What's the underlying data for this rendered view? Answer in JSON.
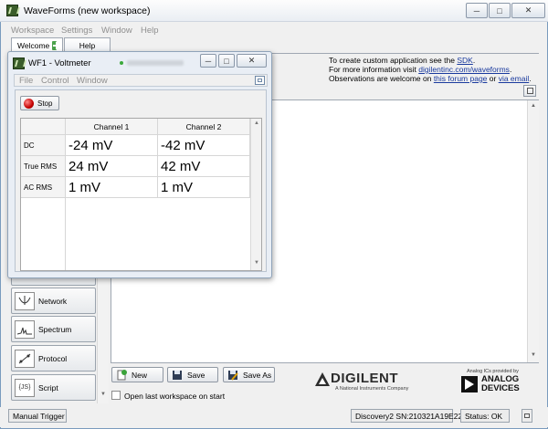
{
  "main_window": {
    "title": "WaveForms  (new workspace)",
    "menu": [
      "Workspace",
      "Settings",
      "Window",
      "Help"
    ],
    "tabs": [
      {
        "label": "Welcome"
      },
      {
        "label": "Help"
      }
    ]
  },
  "info": {
    "line1_prefix": "To create custom application see the ",
    "line1_link": "SDK",
    "line1_suffix": ".",
    "line2_prefix": "For more information visit ",
    "line2_link": "digilentinc.com/waveforms",
    "line2_suffix": ".",
    "line3_prefix": "Observations are welcome on ",
    "line3_link1": "this forum page",
    "line3_mid": " or ",
    "line3_link2": "via email",
    "line3_suffix": "."
  },
  "sidebar": {
    "items": [
      {
        "label": "Network",
        "icon": "network-icon"
      },
      {
        "label": "Spectrum",
        "icon": "spectrum-icon"
      },
      {
        "label": "Protocol",
        "icon": "protocol-icon"
      },
      {
        "label": "Script",
        "icon_text": "{JS}",
        "icon": "script-icon"
      }
    ]
  },
  "bottom": {
    "new_label": "New",
    "save_label": "Save",
    "saveas_label": "Save As",
    "open_last_label": "Open last workspace on start",
    "open_last_checked": false
  },
  "logos": {
    "digilent_name": "DIGILENT",
    "digilent_tag": "A National Instruments Company",
    "adi_caption": "Analog ICs provided by",
    "adi_line1": "ANALOG",
    "adi_line2": "DEVICES"
  },
  "status": {
    "trigger_label": "Manual Trigger",
    "device": "Discovery2 SN:210321A19E22",
    "status_text": "Status: OK"
  },
  "voltmeter": {
    "title": "WF1 - Voltmeter",
    "menu": [
      "File",
      "Control",
      "Window"
    ],
    "stop_label": "Stop",
    "columns": [
      "Channel 1",
      "Channel 2"
    ],
    "rows": [
      {
        "label": "DC",
        "ch1": "-24 mV",
        "ch2": "-42 mV"
      },
      {
        "label": "True RMS",
        "ch1": "24 mV",
        "ch2": "42 mV"
      },
      {
        "label": "AC RMS",
        "ch1": "1 mV",
        "ch2": "1 mV"
      }
    ]
  }
}
